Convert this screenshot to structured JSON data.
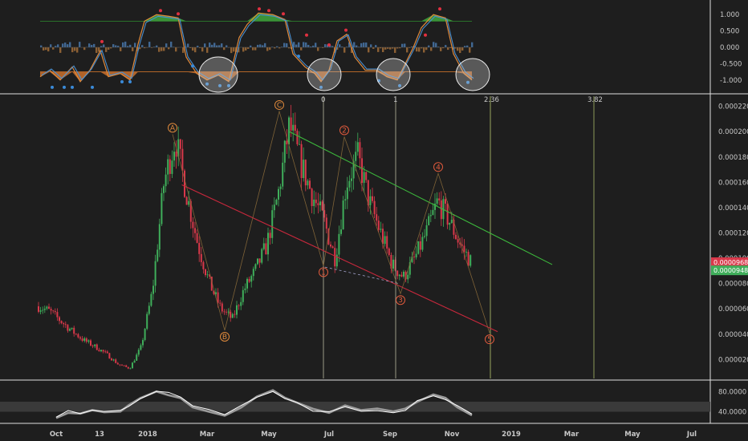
{
  "chart_data": [
    {
      "panel": "oscillator-top",
      "type": "area",
      "y_ticks": [
        "1.000",
        "0.500",
        "0.000",
        "-0.500",
        "-1.000"
      ],
      "ylim": [
        -1.3,
        1.3
      ],
      "upper_level": 0.8,
      "lower_level": -0.75,
      "colors": {
        "line_orange": "#e08a3c",
        "line_blue": "#4a8fd0",
        "fill_green": "#3d9a3a",
        "fill_orange": "#b8672a",
        "level_green": "#2e8b2e",
        "level_orange": "#c8702a"
      }
    },
    {
      "panel": "price",
      "type": "candlestick",
      "y_ticks": [
        "0.00022000",
        "0.00020000",
        "0.00018000",
        "0.00016000",
        "0.00014000",
        "0.00012000",
        "0.00010000",
        "0.00008000",
        "0.00006000",
        "0.00004000",
        "0.00002000"
      ],
      "ylim": [
        5e-06,
        0.000228
      ],
      "x_ticks": [
        "Oct",
        "13",
        "2018",
        "Mar",
        "May",
        "Jul",
        "Sep",
        "Nov",
        "2019",
        "Mar",
        "May",
        "Jul"
      ],
      "series_close": [
        6.2e-05,
        5.8e-05,
        5e-05,
        4.2e-05,
        3.5e-05,
        3e-05,
        2.4e-05,
        1.6e-05,
        1.3e-05,
        3e-05,
        7.5e-05,
        0.00016,
        0.000195,
        0.00015,
        0.00011,
        8e-05,
        6e-05,
        5.2e-05,
        7.5e-05,
        9e-05,
        0.00011,
        0.00015,
        0.000205,
        0.000175,
        0.00015,
        0.00013,
        0.0001,
        0.00016,
        0.00018,
        0.000145,
        0.00012,
        9.5e-05,
        8.5e-05,
        0.0001,
        0.00012,
        0.000145,
        0.00013,
        0.00011,
        9.6e-05
      ],
      "last_price": "0.00009687",
      "second_price": "0.00009486",
      "wave_labels": [
        {
          "label": "A",
          "x_index": 12,
          "value": 0.000198,
          "color": "#e08a3c"
        },
        {
          "label": "B",
          "x_index": 16,
          "value": 4.3e-05,
          "color": "#e08a3c"
        },
        {
          "label": "C",
          "x_index": 22,
          "value": 0.000216,
          "color": "#e08a3c"
        },
        {
          "label": "1",
          "x_index": 27,
          "value": 9.4e-05,
          "color": "#e05a3c"
        },
        {
          "label": "2",
          "x_index": 29,
          "value": 0.000196,
          "color": "#e05a3c"
        },
        {
          "label": "3",
          "x_index": 35,
          "value": 7.2e-05,
          "color": "#e05a3c"
        },
        {
          "label": "4",
          "x_index": 38,
          "value": 0.000167,
          "color": "#e05a3c"
        },
        {
          "label": "5",
          "x_index": 44,
          "value": 4.1e-05,
          "color": "#e05a3c"
        }
      ],
      "fib_times": [
        "0",
        "1",
        "2.36",
        "3.82"
      ],
      "channel_colors": {
        "upper": "#3cb83c",
        "lower": "#c8283c"
      }
    },
    {
      "panel": "rsi-bottom",
      "type": "line",
      "y_ticks": [
        "80.0000",
        "40.0000"
      ],
      "ylim": [
        20,
        100
      ],
      "band": [
        40,
        60
      ]
    }
  ]
}
